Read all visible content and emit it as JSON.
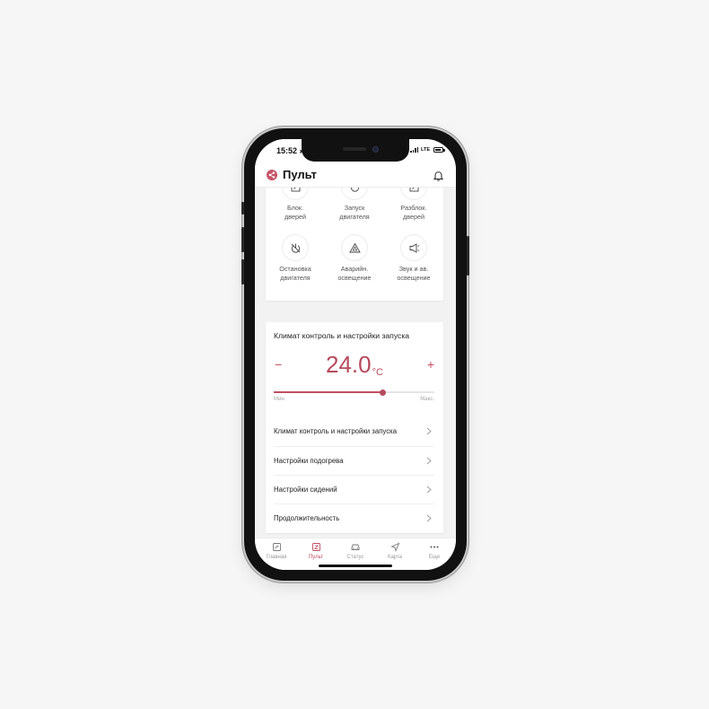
{
  "status_bar": {
    "time": "15:52",
    "network": "LTE"
  },
  "header": {
    "title": "Пульт",
    "logo_icon": "share-icon",
    "notification_icon": "bell-icon"
  },
  "actions": [
    {
      "label": "Блок.\nдверей",
      "icon": "lock-door-icon"
    },
    {
      "label": "Запуск\nдвигателя",
      "icon": "power-icon"
    },
    {
      "label": "Разблок.\nдверей",
      "icon": "unlock-door-icon"
    },
    {
      "label": "Остановка\nдвигателя",
      "icon": "power-off-icon"
    },
    {
      "label": "Аварийн.\nосвещение",
      "icon": "hazard-icon"
    },
    {
      "label": "Звук и ав.\nосвещение",
      "icon": "horn-icon"
    }
  ],
  "climate": {
    "title": "Климат контроль и настройки запуска",
    "minus": "−",
    "plus": "+",
    "temperature": "24.0",
    "unit": "°C",
    "slider_level": 0.68,
    "slider_min_label": "Мин.",
    "slider_max_label": "Макс."
  },
  "menu": [
    {
      "label": "Климат контроль и настройки запуска"
    },
    {
      "label": "Настройки подогрева"
    },
    {
      "label": "Настройки сидений"
    },
    {
      "label": "Продолжительность"
    }
  ],
  "tabs": [
    {
      "label": "Главная",
      "icon": "home-icon",
      "active": false
    },
    {
      "label": "Пульт",
      "icon": "remote-icon",
      "active": true
    },
    {
      "label": "Статус",
      "icon": "car-icon",
      "active": false
    },
    {
      "label": "Карта",
      "icon": "navigation-icon",
      "active": false
    },
    {
      "label": "Еще",
      "icon": "more-icon",
      "active": false
    }
  ],
  "colors": {
    "accent": "#c24d61",
    "background": "#f2f2f2",
    "card": "#ffffff"
  }
}
